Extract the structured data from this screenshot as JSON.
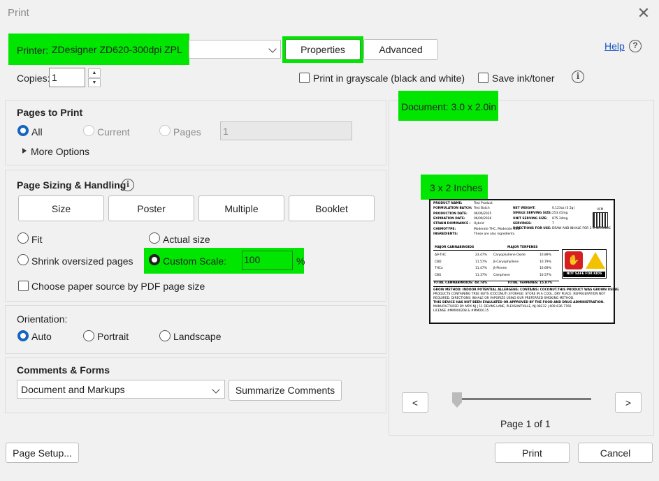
{
  "window": {
    "title": "Print"
  },
  "printer": {
    "label": "Printer:",
    "value": "ZDesigner ZD620-300dpi ZPL",
    "properties": "Properties",
    "advanced": "Advanced",
    "help": "Help"
  },
  "copies": {
    "label": "Copies:",
    "value": "1"
  },
  "options": {
    "grayscale": "Print in grayscale (black and white)",
    "save_ink": "Save ink/toner"
  },
  "pages_to_print": {
    "title": "Pages to Print",
    "all": "All",
    "current": "Current",
    "pages": "Pages",
    "pages_value": "1",
    "more_options": "More Options"
  },
  "page_sizing": {
    "title": "Page Sizing & Handling",
    "tabs": [
      "Size",
      "Poster",
      "Multiple",
      "Booklet"
    ],
    "fit": "Fit",
    "actual_size": "Actual size",
    "shrink": "Shrink oversized pages",
    "custom_scale": "Custom Scale:",
    "scale_value": "100",
    "percent": "%",
    "paper_source": "Choose paper source by PDF page size"
  },
  "orientation": {
    "title": "Orientation:",
    "auto": "Auto",
    "portrait": "Portrait",
    "landscape": "Landscape"
  },
  "comments_forms": {
    "title": "Comments & Forms",
    "select": "Document and Markups",
    "summarize": "Summarize Comments"
  },
  "preview": {
    "document_label": "Document: 3.0 x 2.0in",
    "size_label": "3 x 2 Inches",
    "page_indicator": "Page 1 of 1",
    "prev": "<",
    "next": ">"
  },
  "label": {
    "left_fields": [
      [
        "PRODUCT NAME:",
        "Test Product"
      ],
      [
        "FORMULATION BATCH:",
        "Test Batch"
      ],
      [
        "PRODUCTION DATE:",
        "06/06/2025"
      ],
      [
        "EXPIRATION DATE:",
        "06/09/2026"
      ],
      [
        "STRAIN DOMINANCE :",
        "Hybrid"
      ],
      [
        "CHEMOTYPE:",
        "Moderate THC, Moderate CBD"
      ],
      [
        "INGREDIENTS:",
        "These are also ingredients."
      ]
    ],
    "right_fields": [
      [
        "NET WEIGHT:",
        "0.123oz (3.5g)"
      ],
      [
        "SINGLE SERVING SIZE:",
        "253.41mg"
      ],
      [
        "UNIT SERVING SIZE:",
        "875.34mg"
      ],
      [
        "SERVINGS:",
        "7"
      ],
      [
        "DIRECTIONS FOR USE:",
        "DRAW AND INHALE FOR 1-3 SECONDS"
      ]
    ],
    "cannabinoids_header": "MAJOR CANNABINOIDS",
    "terpenes_header": "MAJOR TERPENES",
    "cannabinoids": [
      [
        "Δ9-THC",
        "23.47%"
      ],
      [
        "CBD",
        "11.57%"
      ],
      [
        "THCa",
        "11.47%"
      ],
      [
        "CBG",
        "11.37%"
      ]
    ],
    "terpenes": [
      [
        "Caryophyllene Oxide",
        "10.89%"
      ],
      [
        "β-Caryophyllene",
        "10.79%"
      ],
      [
        "β-Pinene",
        "10.69%"
      ],
      [
        "Camphene",
        "10.57%"
      ]
    ],
    "total_cannabinoids": [
      "TOTAL CANNABINOIDS:",
      "48.74%"
    ],
    "total_terpenes": [
      "TOTAL TERPENES:",
      "15.87%"
    ],
    "warning": "NOT SAFE FOR KIDS",
    "ucm": "UCM",
    "footer": [
      "GROW METHOD: INDOOR POTENTIAL ALLERGENS: CONTAINS: COCONUT.THIS PRODUCT WAS GROWN USING",
      "PRODUCTS CONTAINING TREE NUTS (COCONUT).STORAGE: STORE IN A COOL, DRY PLACE. REFRIGERATION NOT",
      "REQUIRED.  DIRECTIONS: INHALE OR VAPORIZE USING OUR PREFERRED SMOKING METHOD.",
      "THIS DEVICE HAS NOT BEEN EVALUATED OR APPROVED BY THE FOOD AND DRUG ADMINISTRATION.",
      "MANUFACTURED BY: MPX NJ | 11 DEVINS LANE, PLEASANTVILLE, NJ 08232 | 609-636-7766",
      "LICENSE #MM000208 & #MM00115"
    ]
  },
  "footer": {
    "page_setup": "Page Setup...",
    "print": "Print",
    "cancel": "Cancel"
  },
  "colors": {
    "highlight": "#00e600",
    "accent": "#1565c0",
    "link": "#1a56c4"
  }
}
